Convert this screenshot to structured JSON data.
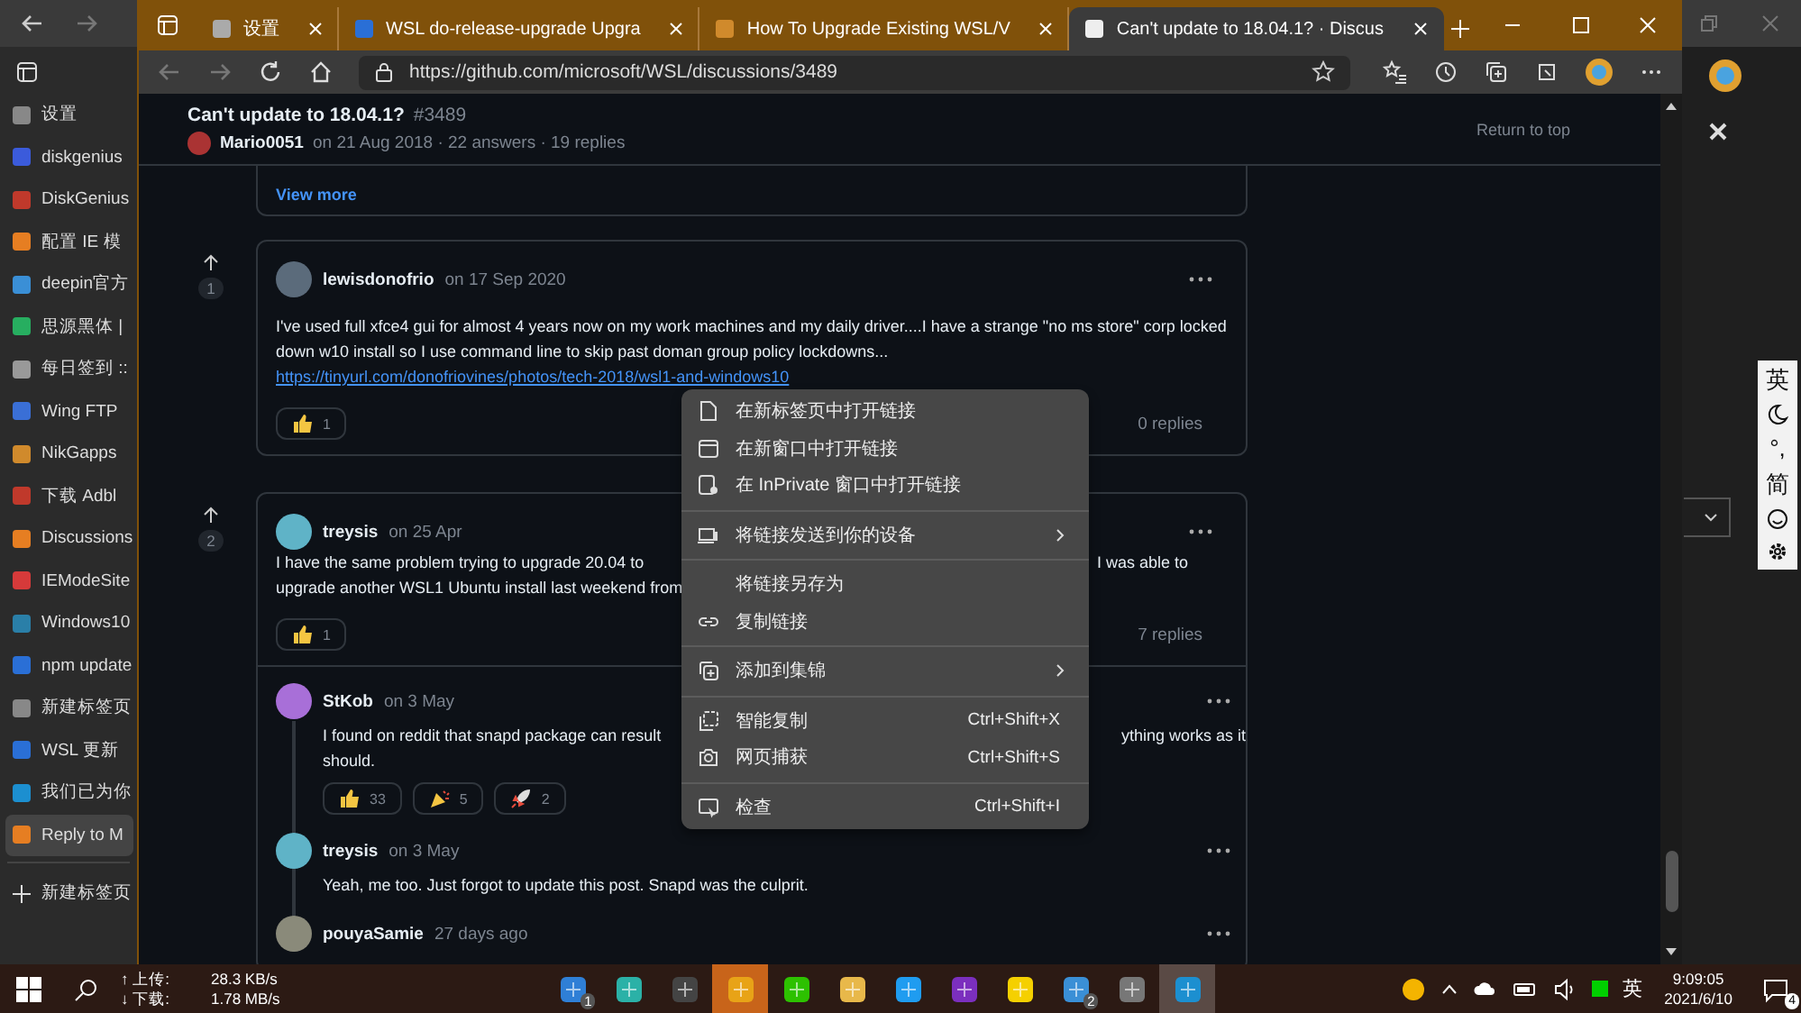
{
  "background_window": {
    "sidebar_items": [
      {
        "label": "设置",
        "selected": false
      },
      {
        "label": "diskgenius",
        "selected": false
      },
      {
        "label": "DiskGenius",
        "selected": false
      },
      {
        "label": "配置 IE 模",
        "selected": false
      },
      {
        "label": "deepin官方",
        "selected": false
      },
      {
        "label": "思源黑体 |",
        "selected": false
      },
      {
        "label": "每日签到 ::",
        "selected": false
      },
      {
        "label": "Wing FTP",
        "selected": false
      },
      {
        "label": "NikGapps",
        "selected": false
      },
      {
        "label": "下载 Adbl",
        "selected": false
      },
      {
        "label": "Discussions",
        "selected": false
      },
      {
        "label": "IEModeSite",
        "selected": false
      },
      {
        "label": "Windows10",
        "selected": false
      },
      {
        "label": "npm update",
        "selected": false
      },
      {
        "label": "新建标签页",
        "selected": false
      },
      {
        "label": "WSL 更新",
        "selected": false
      },
      {
        "label": "我们已为你",
        "selected": false
      },
      {
        "label": "Reply to M",
        "selected": true
      }
    ],
    "new_tab": "新建标签页",
    "ime_toolbar": {
      "language": "英",
      "punctuation": "°,",
      "script": "简"
    }
  },
  "window": {
    "tabs": [
      {
        "title": "设置",
        "selected": false
      },
      {
        "title": "WSL do-release-upgrade Upgra",
        "selected": false
      },
      {
        "title": "How To Upgrade Existing WSL/V",
        "selected": false
      },
      {
        "title": "Can't update to 18.04.1? · Discus",
        "selected": true
      }
    ],
    "address": "https://github.com/microsoft/WSL/discussions/3489"
  },
  "discussion": {
    "title": "Can't update to 18.04.1?",
    "number": "#3489",
    "author": "Mario0051",
    "meta": "on 21 Aug 2018 · 22 answers · 19 replies",
    "return_to_top": "Return to top",
    "view_more": "View more",
    "answers": [
      {
        "votes": "1",
        "author": "lewisdonofrio",
        "date": "on 17 Sep 2020",
        "body": "I've used full xfce4 gui for almost 4 years now on my work machines and my daily driver....I have a strange \"no ms store\" corp locked down w10 install so I use command line to skip past doman group policy lockdowns...",
        "link": "https://tinyurl.com/donofriovines/photos/tech-2018/wsl1-and-windows10",
        "reactions": [
          {
            "kind": "thumbs_up",
            "count": "1"
          }
        ],
        "replies_count": "0 replies"
      },
      {
        "votes": "2",
        "author": "treysis",
        "date": "on 25 Apr",
        "lines": [
          {
            "left": "I have the same problem trying to upgrade 20.04 to",
            "right": "I was able to"
          },
          {
            "left": "upgrade another WSL1 Ubuntu install last weekend from"
          }
        ],
        "reactions": [
          {
            "kind": "thumbs_up",
            "count": "1"
          }
        ],
        "replies_count": "7 replies",
        "replies": [
          {
            "author": "StKob",
            "date": "on 3 May",
            "lines": [
              {
                "left": "I found on reddit that snapd package can result",
                "right": "ything works as it"
              },
              {
                "left": "should."
              }
            ],
            "reactions": [
              {
                "kind": "thumbs_up",
                "count": "33"
              },
              {
                "kind": "party",
                "count": "5"
              },
              {
                "kind": "rocket",
                "count": "2"
              }
            ]
          },
          {
            "author": "treysis",
            "date": "on 3 May",
            "lines": [
              {
                "left": "Yeah, me too. Just forgot to update this post. Snapd was the culprit."
              }
            ]
          },
          {
            "author": "pouyaSamie",
            "date": "27 days ago"
          }
        ]
      }
    ]
  },
  "context_menu": {
    "sections": [
      [
        {
          "label": "在新标签页中打开链接",
          "submenu": false
        },
        {
          "label": "在新窗口中打开链接",
          "submenu": false
        },
        {
          "label": "在 InPrivate 窗口中打开链接",
          "submenu": false
        }
      ],
      [
        {
          "label": "将链接发送到你的设备",
          "submenu": true
        }
      ],
      [
        {
          "label": "将链接另存为",
          "submenu": false
        },
        {
          "label": "复制链接",
          "submenu": false
        }
      ],
      [
        {
          "label": "添加到集锦",
          "submenu": true
        }
      ],
      [
        {
          "label": "智能复制",
          "shortcut": "Ctrl+Shift+X",
          "submenu": false
        },
        {
          "label": "网页捕获",
          "shortcut": "Ctrl+Shift+S",
          "submenu": false
        }
      ],
      [
        {
          "label": "检查",
          "shortcut": "Ctrl+Shift+I",
          "submenu": false
        }
      ]
    ]
  },
  "taskbar": {
    "upload_label": "↑ 上传:",
    "upload": "28.3 KB/s",
    "download_label": "↓ 下载:",
    "download": "1.78 MB/s",
    "apps": [
      {
        "badge": "1",
        "flashing": false,
        "selected": false
      },
      {
        "flashing": false,
        "selected": false
      },
      {
        "flashing": false,
        "selected": false
      },
      {
        "flashing": true,
        "selected": false
      },
      {
        "flashing": false,
        "selected": false
      },
      {
        "flashing": false,
        "selected": false
      },
      {
        "flashing": false,
        "selected": false
      },
      {
        "flashing": false,
        "selected": false
      },
      {
        "flashing": false,
        "selected": false
      },
      {
        "badge": "2",
        "flashing": false,
        "selected": false
      },
      {
        "flashing": false,
        "selected": false
      },
      {
        "flashing": false,
        "selected": true
      }
    ],
    "input_language": "英",
    "time": "9:09:05",
    "date": "2021/6/10",
    "notifications": "4"
  }
}
